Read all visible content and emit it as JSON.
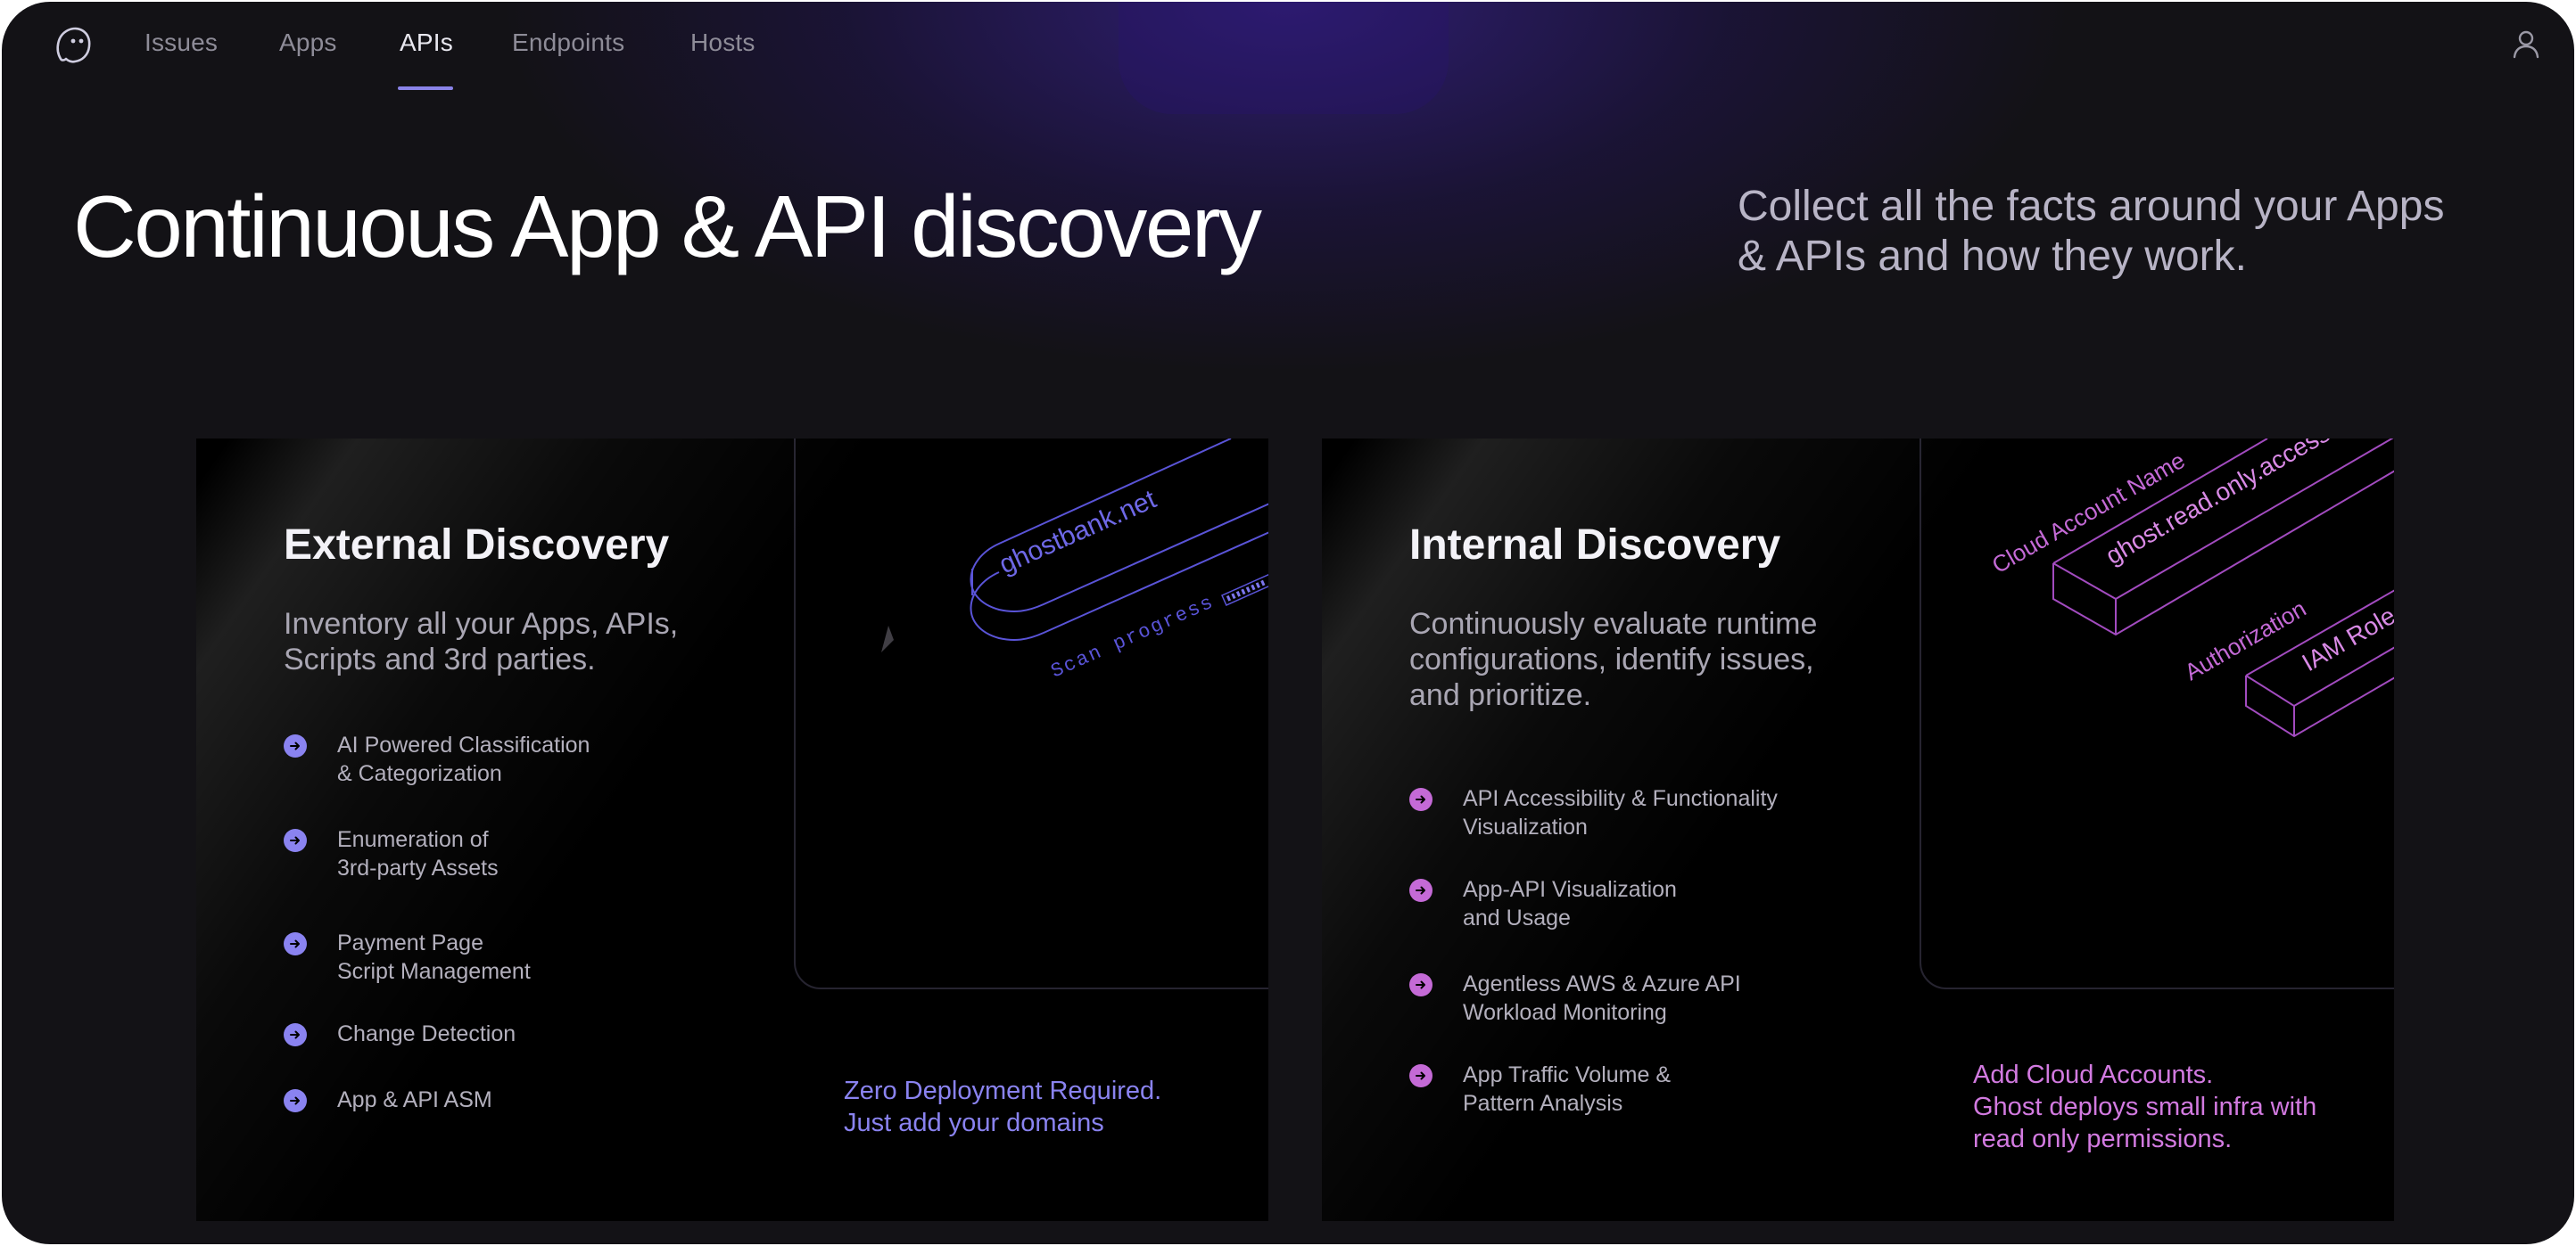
{
  "nav": {
    "items": [
      "Issues",
      "Apps",
      "APIs",
      "Endpoints",
      "Hosts"
    ],
    "active": "APIs"
  },
  "hero": {
    "title": "Continuous App & API discovery",
    "subtitle": "Collect all the facts around your Apps & APIs and how they work."
  },
  "external": {
    "title": "External Discovery",
    "description": "Inventory all your Apps, APIs, Scripts and 3rd parties.",
    "features": [
      "AI Powered Classification\n& Categorization",
      "Enumeration of\n3rd-party Assets",
      "Payment Page\nScript Management",
      "Change Detection",
      "App & API ASM"
    ],
    "note": "Zero Deployment Required.\nJust add your domains",
    "illustration": {
      "domain": "ghostbank.net",
      "scan_label": "Scan progress"
    },
    "accent": "#8a83f0"
  },
  "internal": {
    "title": "Internal Discovery",
    "description": "Continuously evaluate runtime configurations, identify issues, and prioritize.",
    "features": [
      "API Accessibility & Functionality\nVisualization",
      "App-API Visualization\nand Usage",
      "Agentless AWS & Azure API\nWorkload Monitoring",
      "App Traffic Volume &\nPattern Analysis"
    ],
    "note": "Add Cloud Accounts.\nGhost deploys small infra with\nread only permissions.",
    "illustration": {
      "account_label": "Cloud Account Name",
      "access_label": "ghost.read.only.access",
      "auth_label": "Authorization",
      "role_label": "IAM Role"
    },
    "accent": "#c46ad6"
  }
}
